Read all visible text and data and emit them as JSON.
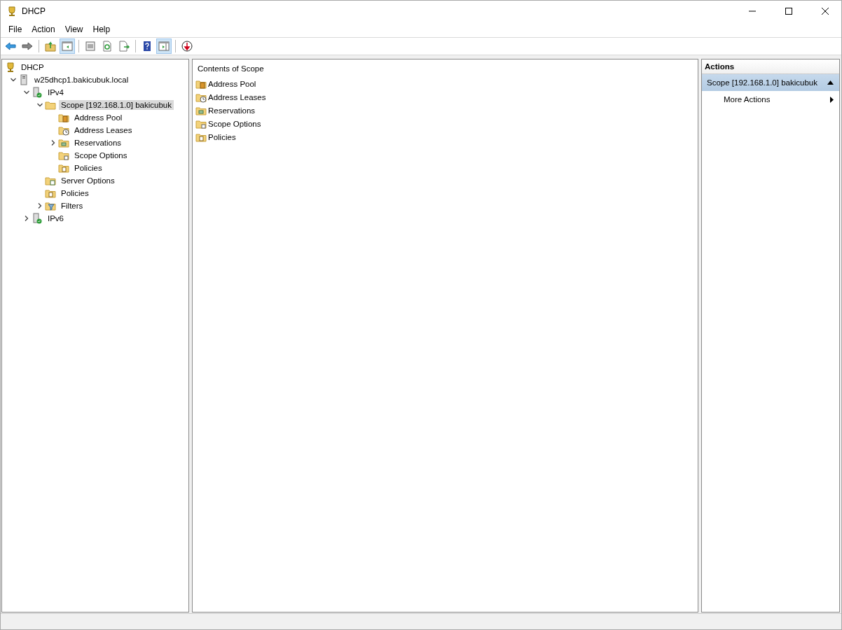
{
  "window": {
    "title": "DHCP"
  },
  "menu": [
    "File",
    "Action",
    "View",
    "Help"
  ],
  "toolbar": [
    {
      "kind": "back",
      "pressed": false
    },
    {
      "kind": "forward",
      "pressed": false
    },
    {
      "kind": "sep"
    },
    {
      "kind": "up",
      "pressed": false
    },
    {
      "kind": "tree-toggle",
      "pressed": true
    },
    {
      "kind": "sep"
    },
    {
      "kind": "properties",
      "pressed": false
    },
    {
      "kind": "refresh",
      "pressed": false
    },
    {
      "kind": "export",
      "pressed": false
    },
    {
      "kind": "sep"
    },
    {
      "kind": "help",
      "pressed": false
    },
    {
      "kind": "action-toggle",
      "pressed": true
    },
    {
      "kind": "sep"
    },
    {
      "kind": "stop",
      "pressed": false
    }
  ],
  "tree": [
    {
      "label": "DHCP",
      "kind": "root",
      "selected": false,
      "children": [
        {
          "label": "w25dhcp1.bakicubuk.local",
          "kind": "server",
          "expanded": true,
          "selected": false,
          "children": [
            {
              "label": "IPv4",
              "kind": "protocol",
              "expanded": true,
              "selected": false,
              "children": [
                {
                  "label": "Scope [192.168.1.0] bakicubuk",
                  "kind": "scope",
                  "expanded": true,
                  "selected": true,
                  "children": [
                    {
                      "label": "Address Pool",
                      "kind": "pool",
                      "selected": false
                    },
                    {
                      "label": "Address Leases",
                      "kind": "leases",
                      "selected": false
                    },
                    {
                      "label": "Reservations",
                      "kind": "reservations",
                      "expanded": false,
                      "selected": false
                    },
                    {
                      "label": "Scope Options",
                      "kind": "options",
                      "selected": false
                    },
                    {
                      "label": "Policies",
                      "kind": "policies",
                      "selected": false
                    }
                  ]
                },
                {
                  "label": "Server Options",
                  "kind": "server-options",
                  "selected": false
                },
                {
                  "label": "Policies",
                  "kind": "policies",
                  "selected": false
                },
                {
                  "label": "Filters",
                  "kind": "filters",
                  "expanded": false,
                  "selected": false
                }
              ]
            },
            {
              "label": "IPv6",
              "kind": "protocol",
              "expanded": false,
              "selected": false
            }
          ]
        }
      ]
    }
  ],
  "content": {
    "heading": "Contents of Scope",
    "items": [
      {
        "label": "Address Pool",
        "kind": "pool"
      },
      {
        "label": "Address Leases",
        "kind": "leases"
      },
      {
        "label": "Reservations",
        "kind": "reservations"
      },
      {
        "label": "Scope Options",
        "kind": "options"
      },
      {
        "label": "Policies",
        "kind": "policies"
      }
    ]
  },
  "actions": {
    "title": "Actions",
    "sections": [
      {
        "label": "Scope [192.168.1.0] bakicubuk",
        "expanded": true,
        "items": [
          {
            "label": "More Actions",
            "submenu": true
          }
        ]
      }
    ]
  }
}
